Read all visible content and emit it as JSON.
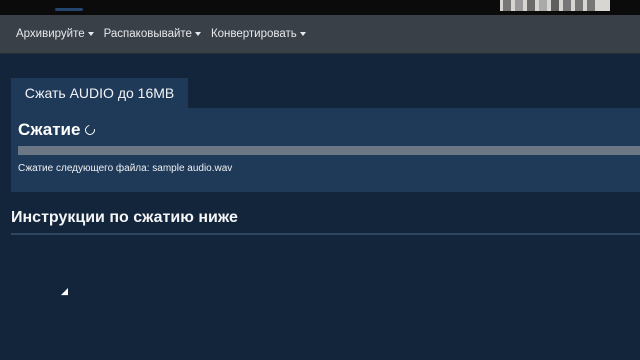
{
  "nav": {
    "items": [
      {
        "label": "Архивируйте"
      },
      {
        "label": "Распаковывайте"
      },
      {
        "label": "Конвертировать"
      }
    ]
  },
  "tab": {
    "label": "Сжать AUDIO до 16MB"
  },
  "panel": {
    "title": "Сжатие",
    "status": "Сжатие следующего файла: sample audio.wav",
    "progress_fraction": 0.0
  },
  "instructions": {
    "heading": "Инструкции по сжатию ниже"
  },
  "colors": {
    "background": "#13253b",
    "panel": "#1f3a58",
    "navbar": "#3a4048",
    "progress_track": "#6b7785"
  }
}
